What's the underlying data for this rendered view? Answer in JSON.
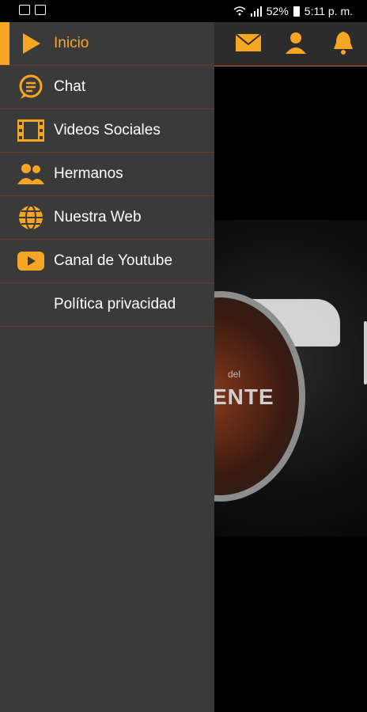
{
  "status_bar": {
    "battery": "52%",
    "time": "5:11 p. m."
  },
  "drawer": {
    "items": [
      {
        "label": "Inicio",
        "icon": "play-icon",
        "active": true
      },
      {
        "label": "Chat",
        "icon": "chat-bubble-icon",
        "active": false
      },
      {
        "label": "Videos Sociales",
        "icon": "film-icon",
        "active": false
      },
      {
        "label": "Hermanos",
        "icon": "people-icon",
        "active": false
      },
      {
        "label": "Nuestra Web",
        "icon": "globe-icon",
        "active": false
      },
      {
        "label": "Canal de Youtube",
        "icon": "youtube-icon",
        "active": false
      },
      {
        "label": "Política privacidad",
        "icon": "",
        "active": false
      }
    ]
  },
  "header_icons": [
    "share-icon",
    "mail-icon",
    "user-icon",
    "bell-icon"
  ],
  "hero": {
    "logo_text": "ENTE",
    "logo_small": "del"
  },
  "colors": {
    "accent": "#f6a623",
    "drawer_bg": "#3a3a3a",
    "divider": "#6b3a24"
  }
}
